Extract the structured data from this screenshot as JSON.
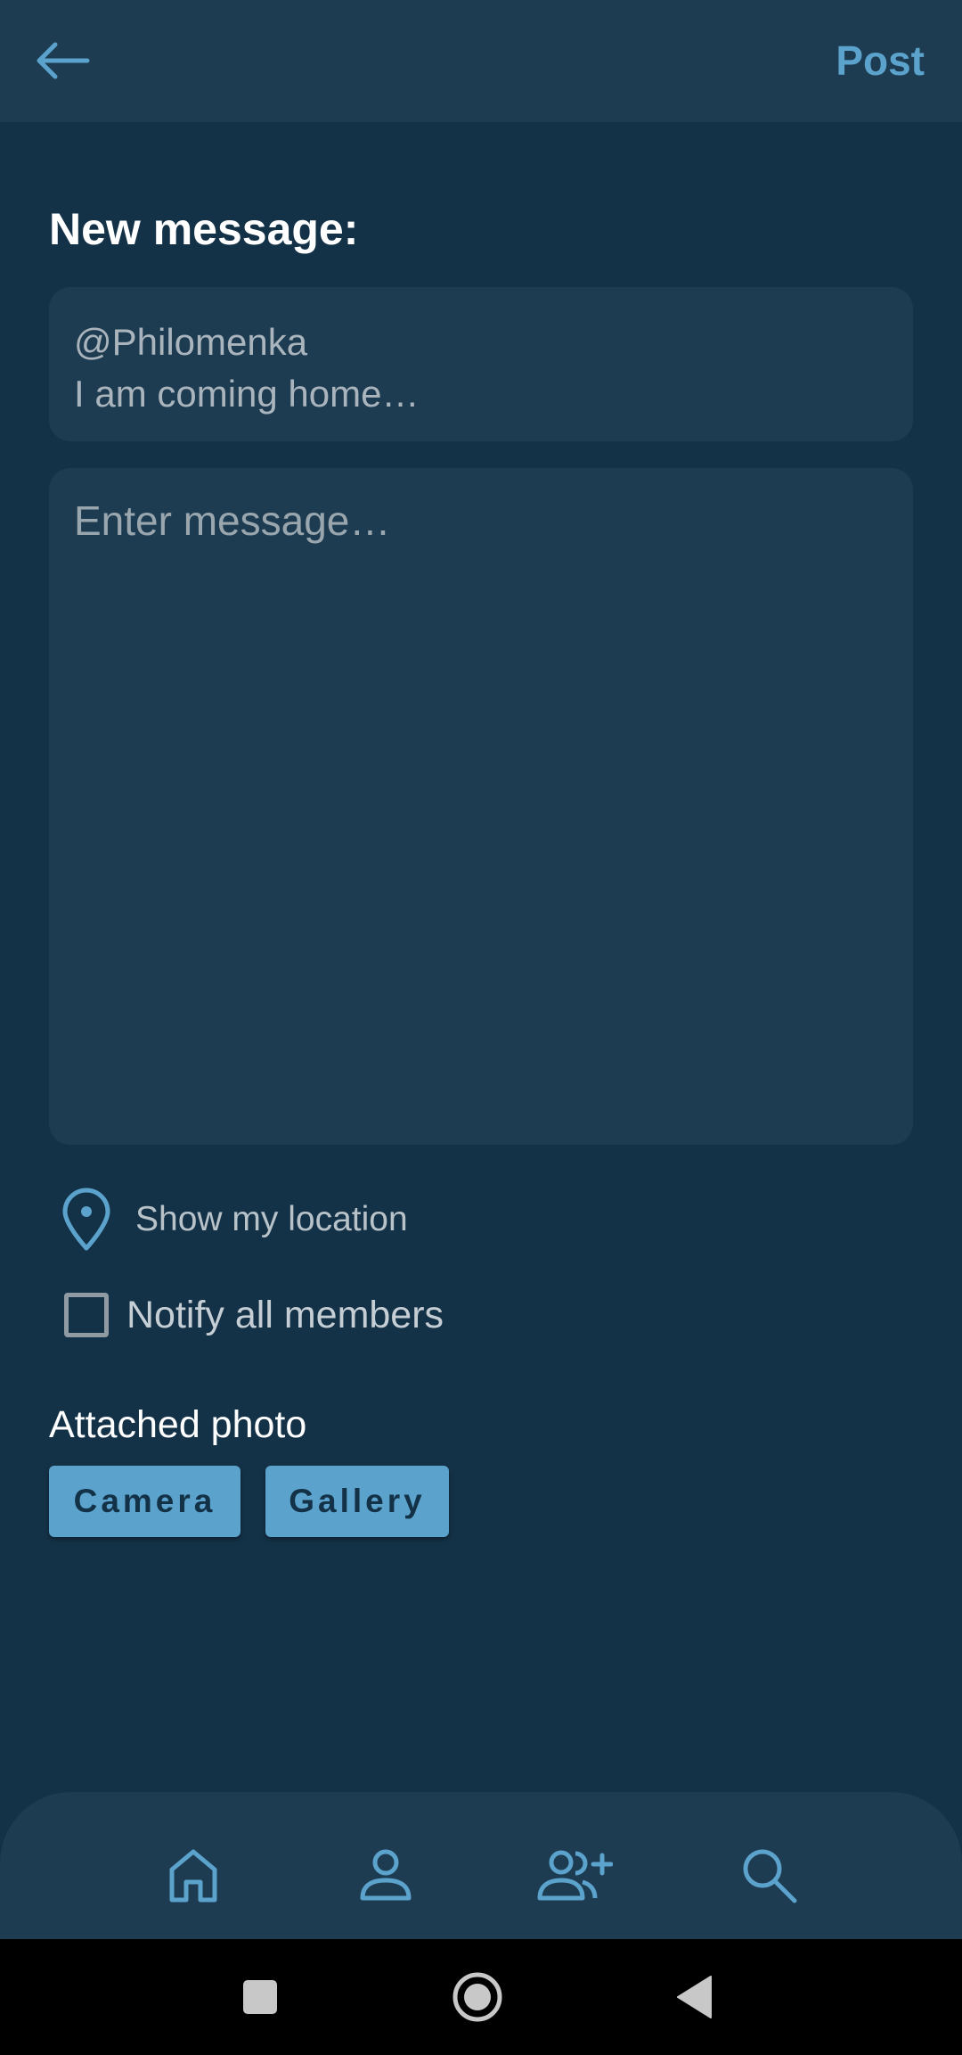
{
  "header": {
    "post_label": "Post",
    "back_icon": "arrow-left-icon"
  },
  "compose": {
    "title": "New message:",
    "reply_to": {
      "mention": "@Philomenka",
      "snippet": "I am coming home…"
    },
    "message_placeholder": "Enter message…",
    "message_value": "",
    "location_label": "Show my location",
    "notify_label": "Notify all members",
    "notify_checked": false
  },
  "attachments": {
    "title": "Attached photo",
    "camera_label": "Camera",
    "gallery_label": "Gallery"
  },
  "bottom_nav": {
    "items": [
      "home-icon",
      "profile-icon",
      "add-member-icon",
      "search-icon"
    ]
  },
  "system_nav": {
    "items": [
      "recents-square-icon",
      "home-circle-icon",
      "back-triangle-icon"
    ]
  },
  "colors": {
    "background": "#143247",
    "surface": "#1e3c51",
    "accent": "#5ba3cc",
    "text_primary": "#ffffff",
    "text_secondary": "#a9b4bc"
  }
}
